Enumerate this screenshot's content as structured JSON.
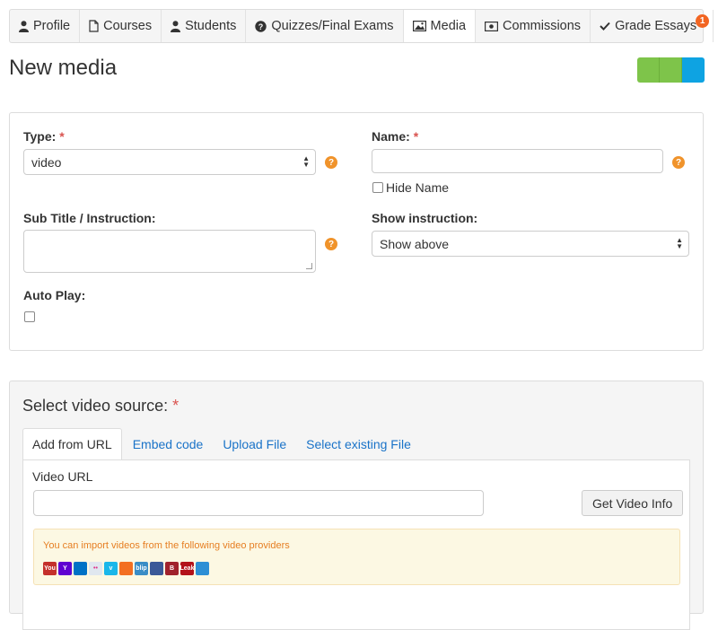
{
  "nav": {
    "items": [
      {
        "label": "Profile",
        "icon": "user-icon"
      },
      {
        "label": "Courses",
        "icon": "file-icon"
      },
      {
        "label": "Students",
        "icon": "user-icon"
      },
      {
        "label": "Quizzes/Final Exams",
        "icon": "question-circle-icon"
      },
      {
        "label": "Media",
        "icon": "image-icon",
        "active": true
      },
      {
        "label": "Commissions",
        "icon": "money-icon"
      },
      {
        "label": "Grade Essays",
        "icon": "check-icon",
        "badge": "1"
      }
    ],
    "logout_icon": "sign-out-icon"
  },
  "page": {
    "title": "New media"
  },
  "colors": {
    "green": "#7ec44a",
    "blue": "#0ea3e2",
    "link": "#1a73c8",
    "required": "#d9534f",
    "help": "#f0932b",
    "alert_text": "#e67e22"
  },
  "form": {
    "type_label": "Type:",
    "required_mark": "*",
    "type_value": "video",
    "name_label": "Name:",
    "name_value": "",
    "hide_name_label": "Hide Name",
    "subtitle_label": "Sub Title / Instruction:",
    "subtitle_value": "",
    "show_instruction_label": "Show instruction:",
    "show_instruction_value": "Show above",
    "autoplay_label": "Auto Play:",
    "help_glyph": "?"
  },
  "source": {
    "title": "Select video source:",
    "required_mark": "*",
    "tabs": [
      {
        "label": "Add from URL",
        "active": true
      },
      {
        "label": "Embed code"
      },
      {
        "label": "Upload File"
      },
      {
        "label": "Select existing File"
      }
    ],
    "video_url_label": "Video URL",
    "video_url_value": "",
    "get_info_button": "Get Video Info",
    "providers_text": "You can import videos from the following video providers",
    "providers": [
      {
        "icon": "youtube-icon",
        "text": "You",
        "color": "#c4302b"
      },
      {
        "icon": "yahoo-icon",
        "text": "Y",
        "color": "#5f01d1"
      },
      {
        "icon": "msn-icon",
        "text": "",
        "color": "#0072c6"
      },
      {
        "icon": "flickr-icon",
        "text": "••",
        "color": "#e0e7ef"
      },
      {
        "icon": "vimeo-icon",
        "text": "v",
        "color": "#1ab7ea"
      },
      {
        "icon": "revver-icon",
        "text": "",
        "color": "#f36f21"
      },
      {
        "icon": "blip-icon",
        "text": "blip",
        "color": "#3a8dc6"
      },
      {
        "icon": "cone-icon",
        "text": "",
        "color": "#3b5998"
      },
      {
        "icon": "b-icon",
        "text": "B",
        "color": "#a0222c"
      },
      {
        "icon": "liveleak-icon",
        "text": "Leak",
        "color": "#b3121a"
      },
      {
        "icon": "chat-icon",
        "text": "",
        "color": "#2d8fd5"
      }
    ]
  }
}
